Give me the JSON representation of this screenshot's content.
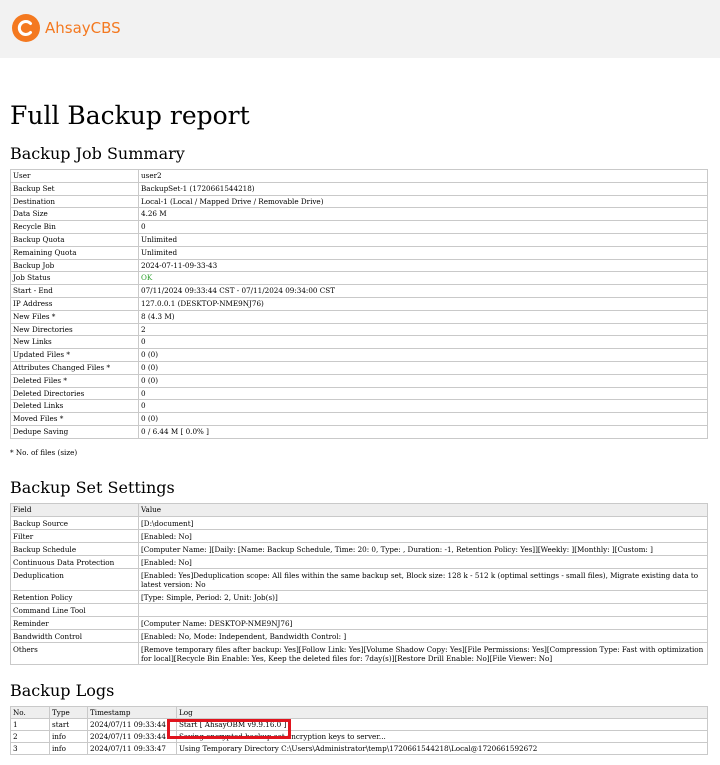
{
  "brand": {
    "name": "AhsayCBS",
    "color": "#f47920"
  },
  "page_title": "Full Backup report",
  "summary": {
    "heading": "Backup Job Summary",
    "rows": [
      {
        "k": "User",
        "v": "user2"
      },
      {
        "k": "Backup Set",
        "v": "BackupSet-1 (1720661544218)"
      },
      {
        "k": "Destination",
        "v": "Local-1 (Local / Mapped Drive / Removable Drive)"
      },
      {
        "k": "Data Size",
        "v": "4.26 M"
      },
      {
        "k": "Recycle Bin",
        "v": "0"
      },
      {
        "k": "Backup Quota",
        "v": "Unlimited"
      },
      {
        "k": "Remaining Quota",
        "v": "Unlimited"
      },
      {
        "k": "Backup Job",
        "v": "2024-07-11-09-33-43"
      },
      {
        "k": "Job Status",
        "v": "OK"
      },
      {
        "k": "Start - End",
        "v": "07/11/2024 09:33:44 CST - 07/11/2024 09:34:00 CST"
      },
      {
        "k": "IP Address",
        "v": "127.0.0.1 (DESKTOP-NME9NJ76)"
      },
      {
        "k": "New Files *",
        "v": "8 (4.3 M)"
      },
      {
        "k": "New Directories",
        "v": "2"
      },
      {
        "k": "New Links",
        "v": "0"
      },
      {
        "k": "Updated Files *",
        "v": "0 (0)"
      },
      {
        "k": "Attributes Changed Files *",
        "v": "0 (0)"
      },
      {
        "k": "Deleted Files *",
        "v": "0 (0)"
      },
      {
        "k": "Deleted Directories",
        "v": "0"
      },
      {
        "k": "Deleted Links",
        "v": "0"
      },
      {
        "k": "Moved Files *",
        "v": "0 (0)"
      },
      {
        "k": "Dedupe Saving",
        "v": "0 / 6.44 M [ 0.0% ]"
      }
    ],
    "note": "* No. of files (size)",
    "status_color": "#2ca02c"
  },
  "settings": {
    "heading": "Backup Set Settings",
    "col_field": "Field",
    "col_value": "Value",
    "rows": [
      {
        "k": "Backup Source",
        "v": "[D:\\document]"
      },
      {
        "k": "Filter",
        "v": "[Enabled: No]"
      },
      {
        "k": "Backup Schedule",
        "v": "[Computer Name: ][Daily: [Name: Backup Schedule, Time: 20: 0, Type: , Duration: -1, Retention Policy: Yes]][Weekly: ][Monthly: ][Custom: ]"
      },
      {
        "k": "Continuous Data Protection",
        "v": "[Enabled: No]"
      },
      {
        "k": "Deduplication",
        "v": "[Enabled: Yes]Deduplication scope: All files within the same backup set, Block size: 128 k - 512 k (optimal settings - small files), Migrate existing data to latest version: No"
      },
      {
        "k": "Retention Policy",
        "v": "[Type: Simple, Period: 2, Unit: Job(s)]"
      },
      {
        "k": "Command Line Tool",
        "v": ""
      },
      {
        "k": "Reminder",
        "v": "[Computer Name: DESKTOP-NME9NJ76]"
      },
      {
        "k": "Bandwidth Control",
        "v": "[Enabled: No, Mode: Independent, Bandwidth Control: ]"
      },
      {
        "k": "Others",
        "v": "[Remove temporary files after backup: Yes][Follow Link: Yes][Volume Shadow Copy: Yes][File Permissions: Yes][Compression Type: Fast with optimization for local][Recycle Bin Enable: Yes, Keep the deleted files for: 7day(s)][Restore Drill Enable: No][File Viewer: No]"
      }
    ]
  },
  "logs": {
    "heading": "Backup Logs",
    "columns": [
      "No.",
      "Type",
      "Timestamp",
      "Log"
    ],
    "rows": [
      {
        "no": "1",
        "type": "start",
        "ts": "2024/07/11 09:33:44",
        "log": "Start [ AhsayOBM v9.9.16.0 ]"
      },
      {
        "no": "2",
        "type": "info",
        "ts": "2024/07/11 09:33:44",
        "log": "Saving encrypted backup set encryption keys to server..."
      },
      {
        "no": "3",
        "type": "info",
        "ts": "2024/07/11 09:33:47",
        "log": "Using Temporary Directory C:\\Users\\Administrator\\temp\\1720661544218\\Local@1720661592672"
      }
    ],
    "highlight_color": "#e0141e"
  }
}
